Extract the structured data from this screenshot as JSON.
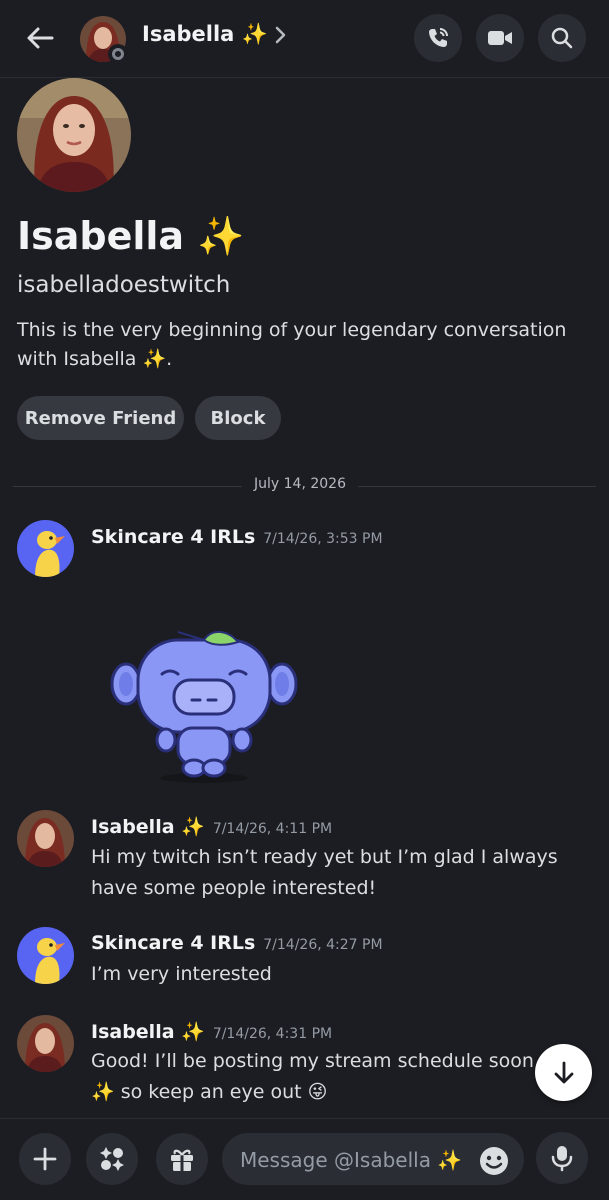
{
  "header": {
    "name": "Isabella ✨",
    "icons": [
      "back-arrow-icon",
      "chevron-right-icon",
      "voice-call-icon",
      "video-call-icon",
      "search-icon"
    ]
  },
  "profile": {
    "display_name": "Isabella ✨",
    "username": "isabelladoestwitch",
    "intro": "This is the very beginning of your legendary conversation with Isabella ✨.",
    "remove_friend_label": "Remove Friend",
    "block_label": "Block"
  },
  "date_divider": "July 14, 2026",
  "messages": [
    {
      "author": "Skincare 4 IRLs",
      "time": "7/14/26, 3:53 PM",
      "text": ""
    },
    {
      "author": "Isabella ✨",
      "time": "7/14/26, 4:11 PM",
      "text": "Hi my twitch isn’t ready yet but I’m glad I always have some people interested!"
    },
    {
      "author": "Skincare 4 IRLs",
      "time": "7/14/26, 4:27 PM",
      "text": "I’m very interested"
    },
    {
      "author": "Isabella ✨",
      "time": "7/14/26, 4:31 PM",
      "text": "Good! I’ll be posting my stream schedule soon ✨ so keep an eye out 😜"
    }
  ],
  "composer": {
    "placeholder": "Message @Isabella ✨",
    "icons": [
      "plus-icon",
      "apps-icon",
      "gift-icon",
      "emoji-icon",
      "microphone-icon"
    ]
  },
  "colors": {
    "background": "#1c1d22",
    "button_bg": "#2b2d34",
    "pill_bg": "#373940",
    "muted_text": "#949ba4",
    "blurple": "#5865f2"
  }
}
